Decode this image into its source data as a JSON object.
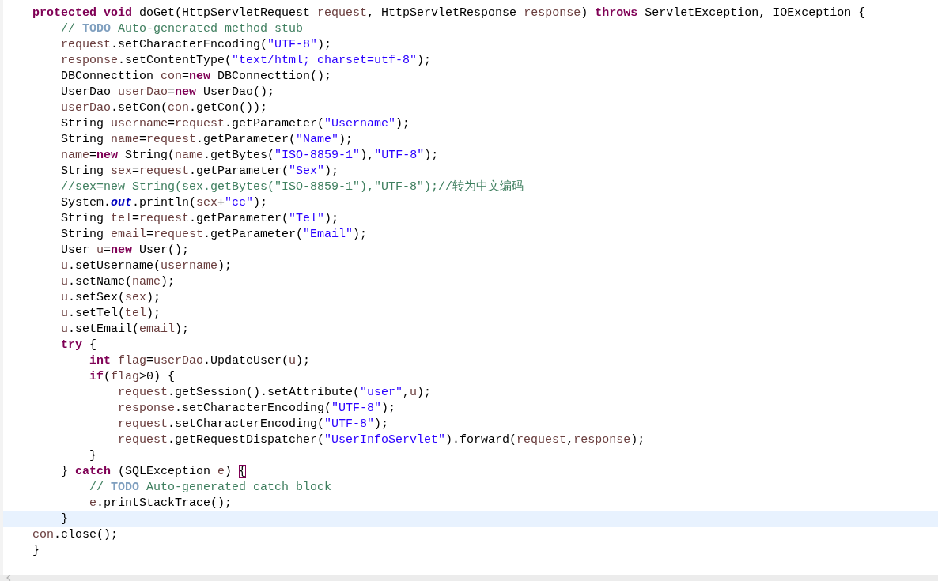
{
  "editor": {
    "lines": [
      {
        "current": false,
        "tokens": [
          {
            "kind": "keyword",
            "text": "protected void"
          },
          {
            "kind": "plain",
            "text": " doGet(HttpServletRequest "
          },
          {
            "kind": "variable",
            "text": "request"
          },
          {
            "kind": "plain",
            "text": ", HttpServletResponse "
          },
          {
            "kind": "variable",
            "text": "response"
          },
          {
            "kind": "plain",
            "text": ") "
          },
          {
            "kind": "keyword",
            "text": "throws"
          },
          {
            "kind": "plain",
            "text": " ServletException, IOException {"
          }
        ],
        "children": [
          {
            "current": false,
            "tokens": [
              {
                "kind": "comment",
                "text": "// "
              },
              {
                "kind": "todo",
                "text": "TODO"
              },
              {
                "kind": "comment",
                "text": " Auto-generated method stub"
              }
            ]
          },
          {
            "current": false,
            "tokens": [
              {
                "kind": "variable",
                "text": "request"
              },
              {
                "kind": "plain",
                "text": ".setCharacterEncoding("
              },
              {
                "kind": "string",
                "text": "\"UTF-8\""
              },
              {
                "kind": "plain",
                "text": ");"
              }
            ]
          },
          {
            "current": false,
            "tokens": [
              {
                "kind": "variable",
                "text": "response"
              },
              {
                "kind": "plain",
                "text": ".setContentType("
              },
              {
                "kind": "string",
                "text": "\"text/html; charset=utf-8\""
              },
              {
                "kind": "plain",
                "text": ");"
              }
            ]
          },
          {
            "current": false,
            "tokens": [
              {
                "kind": "plain",
                "text": "DBConnecttion "
              },
              {
                "kind": "variable",
                "text": "con"
              },
              {
                "kind": "plain",
                "text": "="
              },
              {
                "kind": "keyword",
                "text": "new"
              },
              {
                "kind": "plain",
                "text": " DBConnecttion();"
              }
            ]
          },
          {
            "current": false,
            "tokens": [
              {
                "kind": "plain",
                "text": "UserDao "
              },
              {
                "kind": "variable",
                "text": "userDao"
              },
              {
                "kind": "plain",
                "text": "="
              },
              {
                "kind": "keyword",
                "text": "new"
              },
              {
                "kind": "plain",
                "text": " UserDao();"
              }
            ]
          },
          {
            "current": false,
            "tokens": [
              {
                "kind": "variable",
                "text": "userDao"
              },
              {
                "kind": "plain",
                "text": ".setCon("
              },
              {
                "kind": "variable",
                "text": "con"
              },
              {
                "kind": "plain",
                "text": ".getCon());"
              }
            ]
          },
          {
            "current": false,
            "tokens": [
              {
                "kind": "plain",
                "text": "String "
              },
              {
                "kind": "variable",
                "text": "username"
              },
              {
                "kind": "plain",
                "text": "="
              },
              {
                "kind": "variable",
                "text": "request"
              },
              {
                "kind": "plain",
                "text": ".getParameter("
              },
              {
                "kind": "string",
                "text": "\"Username\""
              },
              {
                "kind": "plain",
                "text": ");"
              }
            ]
          },
          {
            "current": false,
            "tokens": [
              {
                "kind": "plain",
                "text": "String "
              },
              {
                "kind": "variable",
                "text": "name"
              },
              {
                "kind": "plain",
                "text": "="
              },
              {
                "kind": "variable",
                "text": "request"
              },
              {
                "kind": "plain",
                "text": ".getParameter("
              },
              {
                "kind": "string",
                "text": "\"Name\""
              },
              {
                "kind": "plain",
                "text": ");"
              }
            ]
          },
          {
            "current": false,
            "tokens": [
              {
                "kind": "variable",
                "text": "name"
              },
              {
                "kind": "plain",
                "text": "="
              },
              {
                "kind": "keyword",
                "text": "new"
              },
              {
                "kind": "plain",
                "text": " String("
              },
              {
                "kind": "variable",
                "text": "name"
              },
              {
                "kind": "plain",
                "text": ".getBytes("
              },
              {
                "kind": "string",
                "text": "\"ISO-8859-1\""
              },
              {
                "kind": "plain",
                "text": "),"
              },
              {
                "kind": "string",
                "text": "\"UTF-8\""
              },
              {
                "kind": "plain",
                "text": ");"
              }
            ]
          },
          {
            "current": false,
            "tokens": [
              {
                "kind": "plain",
                "text": "String "
              },
              {
                "kind": "variable",
                "text": "sex"
              },
              {
                "kind": "plain",
                "text": "="
              },
              {
                "kind": "variable",
                "text": "request"
              },
              {
                "kind": "plain",
                "text": ".getParameter("
              },
              {
                "kind": "string",
                "text": "\"Sex\""
              },
              {
                "kind": "plain",
                "text": ");"
              }
            ]
          },
          {
            "current": false,
            "tokens": [
              {
                "kind": "comment",
                "text": "//sex=new String(sex.getBytes(\"ISO-8859-1\"),\"UTF-8\");//转为中文编码"
              }
            ]
          },
          {
            "current": false,
            "tokens": [
              {
                "kind": "plain",
                "text": "System."
              },
              {
                "kind": "field",
                "text": "out"
              },
              {
                "kind": "plain",
                "text": ".println("
              },
              {
                "kind": "variable",
                "text": "sex"
              },
              {
                "kind": "plain",
                "text": "+"
              },
              {
                "kind": "string",
                "text": "\"cc\""
              },
              {
                "kind": "plain",
                "text": ");"
              }
            ]
          },
          {
            "current": false,
            "tokens": [
              {
                "kind": "plain",
                "text": "String "
              },
              {
                "kind": "variable",
                "text": "tel"
              },
              {
                "kind": "plain",
                "text": "="
              },
              {
                "kind": "variable",
                "text": "request"
              },
              {
                "kind": "plain",
                "text": ".getParameter("
              },
              {
                "kind": "string",
                "text": "\"Tel\""
              },
              {
                "kind": "plain",
                "text": ");"
              }
            ]
          },
          {
            "current": false,
            "tokens": [
              {
                "kind": "plain",
                "text": "String "
              },
              {
                "kind": "variable",
                "text": "email"
              },
              {
                "kind": "plain",
                "text": "="
              },
              {
                "kind": "variable",
                "text": "request"
              },
              {
                "kind": "plain",
                "text": ".getParameter("
              },
              {
                "kind": "string",
                "text": "\"Email\""
              },
              {
                "kind": "plain",
                "text": ");"
              }
            ]
          },
          {
            "current": false,
            "tokens": [
              {
                "kind": "plain",
                "text": "User "
              },
              {
                "kind": "variable",
                "text": "u"
              },
              {
                "kind": "plain",
                "text": "="
              },
              {
                "kind": "keyword",
                "text": "new"
              },
              {
                "kind": "plain",
                "text": " User();"
              }
            ]
          },
          {
            "current": false,
            "tokens": [
              {
                "kind": "variable",
                "text": "u"
              },
              {
                "kind": "plain",
                "text": ".setUsername("
              },
              {
                "kind": "variable",
                "text": "username"
              },
              {
                "kind": "plain",
                "text": ");"
              }
            ]
          },
          {
            "current": false,
            "tokens": [
              {
                "kind": "variable",
                "text": "u"
              },
              {
                "kind": "plain",
                "text": ".setName("
              },
              {
                "kind": "variable",
                "text": "name"
              },
              {
                "kind": "plain",
                "text": ");"
              }
            ]
          },
          {
            "current": false,
            "tokens": [
              {
                "kind": "variable",
                "text": "u"
              },
              {
                "kind": "plain",
                "text": ".setSex("
              },
              {
                "kind": "variable",
                "text": "sex"
              },
              {
                "kind": "plain",
                "text": ");"
              }
            ]
          },
          {
            "current": false,
            "tokens": [
              {
                "kind": "variable",
                "text": "u"
              },
              {
                "kind": "plain",
                "text": ".setTel("
              },
              {
                "kind": "variable",
                "text": "tel"
              },
              {
                "kind": "plain",
                "text": ");"
              }
            ]
          },
          {
            "current": false,
            "tokens": [
              {
                "kind": "variable",
                "text": "u"
              },
              {
                "kind": "plain",
                "text": ".setEmail("
              },
              {
                "kind": "variable",
                "text": "email"
              },
              {
                "kind": "plain",
                "text": ");"
              }
            ]
          },
          {
            "current": false,
            "tokens": [
              {
                "kind": "keyword",
                "text": "try"
              },
              {
                "kind": "plain",
                "text": " {"
              }
            ],
            "children": [
              {
                "current": false,
                "tokens": [
                  {
                    "kind": "keyword",
                    "text": "int "
                  },
                  {
                    "kind": "variable",
                    "text": "flag"
                  },
                  {
                    "kind": "plain",
                    "text": "="
                  },
                  {
                    "kind": "variable",
                    "text": "userDao"
                  },
                  {
                    "kind": "plain",
                    "text": ".UpdateUser("
                  },
                  {
                    "kind": "variable",
                    "text": "u"
                  },
                  {
                    "kind": "plain",
                    "text": ");"
                  }
                ]
              },
              {
                "current": false,
                "tokens": [
                  {
                    "kind": "keyword",
                    "text": "if"
                  },
                  {
                    "kind": "plain",
                    "text": "("
                  },
                  {
                    "kind": "variable",
                    "text": "flag"
                  },
                  {
                    "kind": "plain",
                    "text": ">0) {"
                  }
                ],
                "children": [
                  {
                    "current": false,
                    "tokens": [
                      {
                        "kind": "variable",
                        "text": "request"
                      },
                      {
                        "kind": "plain",
                        "text": ".getSession().setAttribute("
                      },
                      {
                        "kind": "string",
                        "text": "\"user\""
                      },
                      {
                        "kind": "plain",
                        "text": ","
                      },
                      {
                        "kind": "variable",
                        "text": "u"
                      },
                      {
                        "kind": "plain",
                        "text": ");"
                      }
                    ]
                  },
                  {
                    "current": false,
                    "tokens": [
                      {
                        "kind": "variable",
                        "text": "response"
                      },
                      {
                        "kind": "plain",
                        "text": ".setCharacterEncoding("
                      },
                      {
                        "kind": "string",
                        "text": "\"UTF-8\""
                      },
                      {
                        "kind": "plain",
                        "text": ");"
                      }
                    ]
                  },
                  {
                    "current": false,
                    "tokens": [
                      {
                        "kind": "variable",
                        "text": "request"
                      },
                      {
                        "kind": "plain",
                        "text": ".setCharacterEncoding("
                      },
                      {
                        "kind": "string",
                        "text": "\"UTF-8\""
                      },
                      {
                        "kind": "plain",
                        "text": ");"
                      }
                    ]
                  },
                  {
                    "current": false,
                    "tokens": [
                      {
                        "kind": "variable",
                        "text": "request"
                      },
                      {
                        "kind": "plain",
                        "text": ".getRequestDispatcher("
                      },
                      {
                        "kind": "string",
                        "text": "\"UserInfoServlet\""
                      },
                      {
                        "kind": "plain",
                        "text": ").forward("
                      },
                      {
                        "kind": "variable",
                        "text": "request"
                      },
                      {
                        "kind": "plain",
                        "text": ","
                      },
                      {
                        "kind": "variable",
                        "text": "response"
                      },
                      {
                        "kind": "plain",
                        "text": ");"
                      }
                    ]
                  }
                ]
              },
              {
                "current": false,
                "tokens": [
                  {
                    "kind": "plain",
                    "text": "}"
                  }
                ]
              }
            ]
          },
          {
            "current": false,
            "tokens": [
              {
                "kind": "plain",
                "text": "} "
              },
              {
                "kind": "keyword",
                "text": "catch"
              },
              {
                "kind": "plain",
                "text": " (SQLException "
              },
              {
                "kind": "variable",
                "text": "e"
              },
              {
                "kind": "plain",
                "text": ") "
              },
              {
                "kind": "bracket",
                "text": "{"
              }
            ],
            "children": [
              {
                "current": false,
                "tokens": [
                  {
                    "kind": "comment",
                    "text": "// "
                  },
                  {
                    "kind": "todo",
                    "text": "TODO"
                  },
                  {
                    "kind": "comment",
                    "text": " Auto-generated catch block"
                  }
                ]
              },
              {
                "current": false,
                "tokens": [
                  {
                    "kind": "variable",
                    "text": "e"
                  },
                  {
                    "kind": "plain",
                    "text": ".printStackTrace();"
                  }
                ]
              }
            ]
          },
          {
            "current": true,
            "tokens": [
              {
                "kind": "plain",
                "text": "}"
              }
            ]
          }
        ]
      },
      {
        "current": false,
        "tokens": [
          {
            "kind": "variable",
            "text": "con"
          },
          {
            "kind": "plain",
            "text": ".close();"
          }
        ]
      },
      {
        "current": false,
        "tokens": [
          {
            "kind": "plain",
            "text": "}"
          }
        ]
      }
    ]
  }
}
